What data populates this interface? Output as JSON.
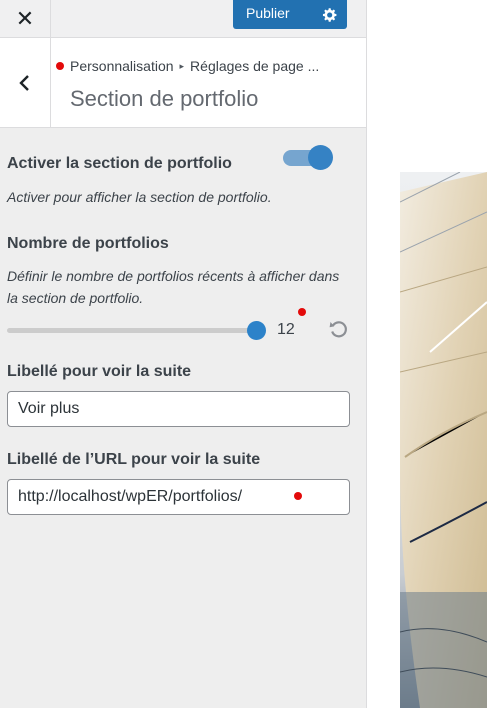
{
  "topbar": {
    "close_icon": "close-icon",
    "publish_label": "Publier",
    "settings_icon": "gear-icon"
  },
  "header": {
    "back_icon": "chevron-left-icon",
    "breadcrumb_parent": "Personnalisation",
    "breadcrumb_current": "Réglages de page ...",
    "title": "Section de portfolio"
  },
  "controls": {
    "enable": {
      "label": "Activer la section de portfolio",
      "description": "Activer pour afficher la section de portfolio.",
      "enabled": true
    },
    "count": {
      "label": "Nombre de portfolios",
      "description": "Définir le nombre de portfolios récents à afficher dans la section de portfolio.",
      "value": "12",
      "reset_icon": "reset-icon"
    },
    "more_label": {
      "label": "Libellé pour voir la suite",
      "value": "Voir plus"
    },
    "more_url": {
      "label": "Libellé de l’URL pour voir la suite",
      "value": "http://localhost/wpER/portfolios/"
    }
  },
  "colors": {
    "accent": "#2271b1",
    "unsaved_dot": "#e30a0a",
    "panel_bg": "#eeeeee"
  },
  "preview": {
    "image": "sailboat-photo"
  }
}
